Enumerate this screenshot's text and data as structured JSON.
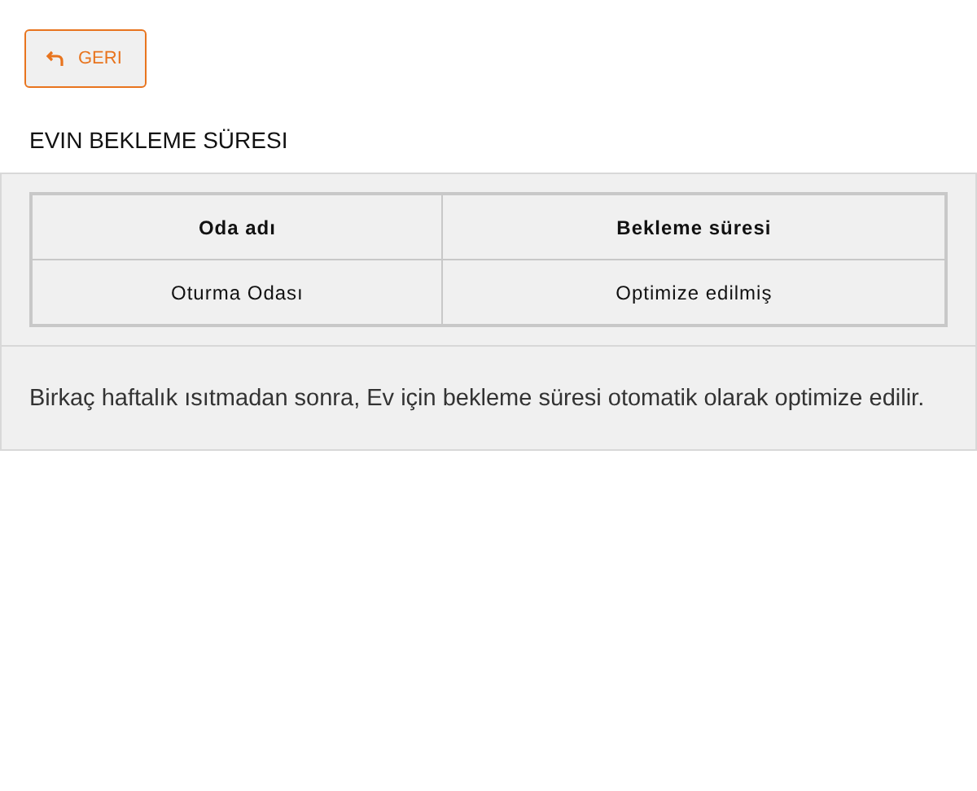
{
  "back_button": {
    "label": "GERI"
  },
  "section_title": "EVIN BEKLEME SÜRESI",
  "table": {
    "columns": [
      "Oda adı",
      "Bekleme süresi"
    ],
    "rows": [
      [
        "Oturma Odası",
        "Optimize edilmiş"
      ]
    ]
  },
  "note": "Birkaç haftalık ısıtmadan sonra, Ev için bekleme süresi otomatik olarak optimize edilir."
}
